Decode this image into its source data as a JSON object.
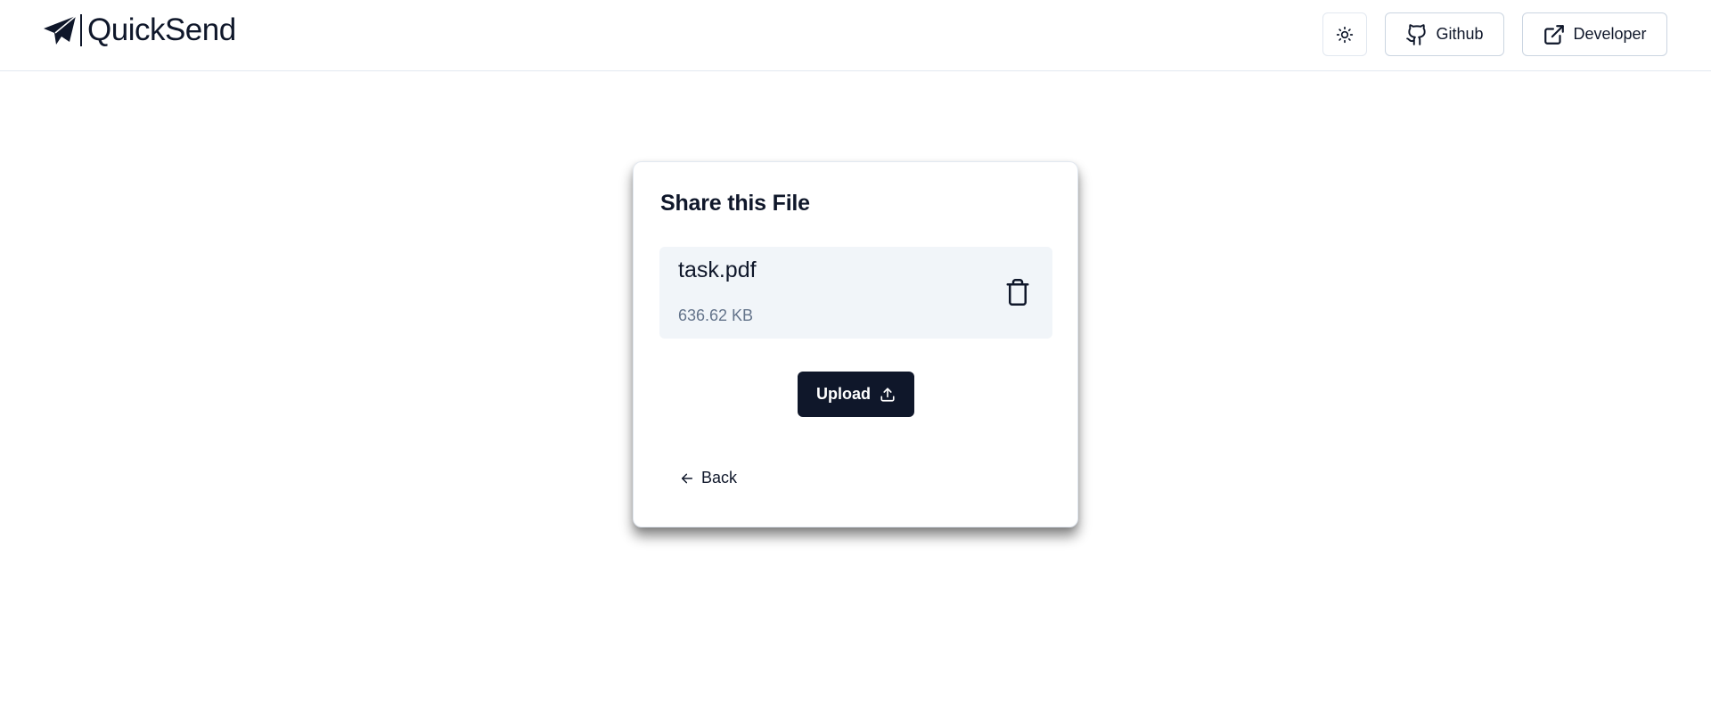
{
  "header": {
    "brand": "QuickSend",
    "logo_icon": "paper-plane-icon",
    "theme_icon": "sun-icon",
    "github_label": "Github",
    "github_icon": "github-icon",
    "developer_label": "Developer",
    "developer_icon": "external-link-icon"
  },
  "card": {
    "title": "Share this File",
    "file": {
      "name": "task.pdf",
      "size": "636.62 KB",
      "delete_icon": "trash-icon"
    },
    "upload_label": "Upload",
    "upload_icon": "upload-icon",
    "back_label": "Back",
    "back_icon": "arrow-left-icon"
  },
  "colors": {
    "primary": "#0f172a",
    "file_box_bg": "#f1f5f9",
    "muted_text": "#64748b",
    "border": "#e2e8f0"
  }
}
